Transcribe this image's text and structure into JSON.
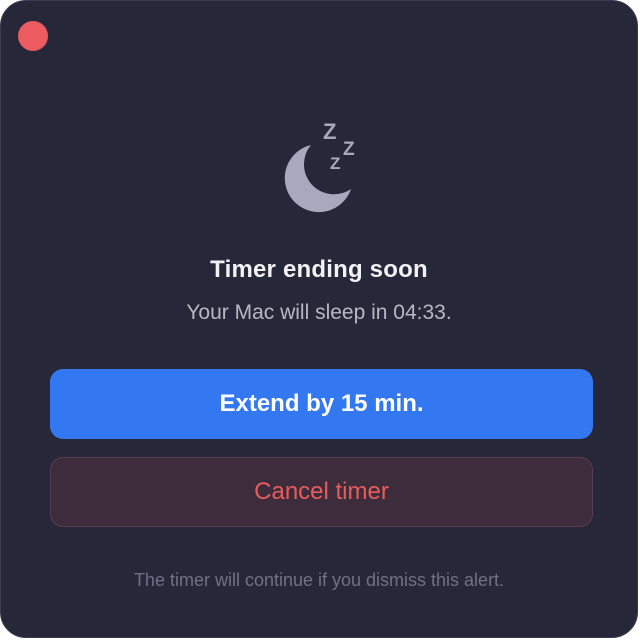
{
  "window": {
    "close_icon": "close-icon"
  },
  "icon": {
    "name": "moon-sleep-icon",
    "z_glyphs": [
      "Z",
      "Z",
      "Z"
    ],
    "color": "#a9a9bd"
  },
  "alert": {
    "title": "Timer ending soon",
    "message": "Your Mac will sleep in 04:33."
  },
  "buttons": {
    "extend_label": "Extend by 15 min.",
    "cancel_label": "Cancel timer"
  },
  "footnote": "The timer will continue if you dismiss this alert.",
  "colors": {
    "background": "#262839",
    "accent": "#3378f1",
    "danger": "#e95c5c",
    "close": "#ec5b5f"
  }
}
